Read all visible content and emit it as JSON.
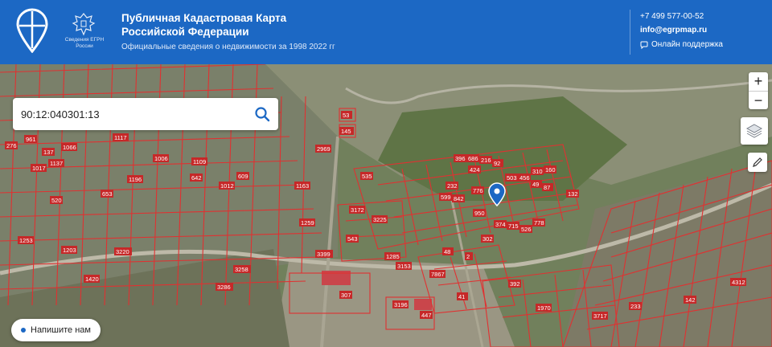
{
  "header": {
    "emblem_caption": "Сведения ЕГРН России",
    "title": "Публичная Кадастровая Карта Российской Федерации",
    "subtitle": "Официальные сведения о недвижимости за 1998 2022 гг",
    "phone": "+7 499 577-00-52",
    "email": "info@egrpmap.ru",
    "support_label": "Онлайн поддержка"
  },
  "search": {
    "value": "90:12:040301:13"
  },
  "controls": {
    "zoom_in": "+",
    "zoom_out": "−"
  },
  "chat": {
    "label": "Напишите нам"
  },
  "map": {
    "accent_color": "#1c68c4",
    "parcel_color": "#e03131",
    "parcel_labels": [
      "276",
      "961",
      "137",
      "1066",
      "1017",
      "1137",
      "520",
      "1196",
      "653",
      "1006",
      "1109",
      "642",
      "1012",
      "609",
      "1163",
      "2969",
      "535",
      "3172",
      "3225",
      "1259",
      "1253",
      "543",
      "3399",
      "1285",
      "3153",
      "307",
      "3196",
      "447",
      "7867",
      "41",
      "392",
      "1970",
      "3717",
      "233",
      "4312",
      "142",
      "53",
      "145",
      "396",
      "686",
      "216",
      "92",
      "310",
      "160",
      "424",
      "503",
      "456",
      "49",
      "87",
      "132",
      "232",
      "599",
      "842",
      "776",
      "374",
      "715",
      "526",
      "48",
      "950",
      "302",
      "2",
      "778",
      "1117",
      "1203",
      "3220",
      "1420",
      "3286",
      "3258"
    ]
  }
}
